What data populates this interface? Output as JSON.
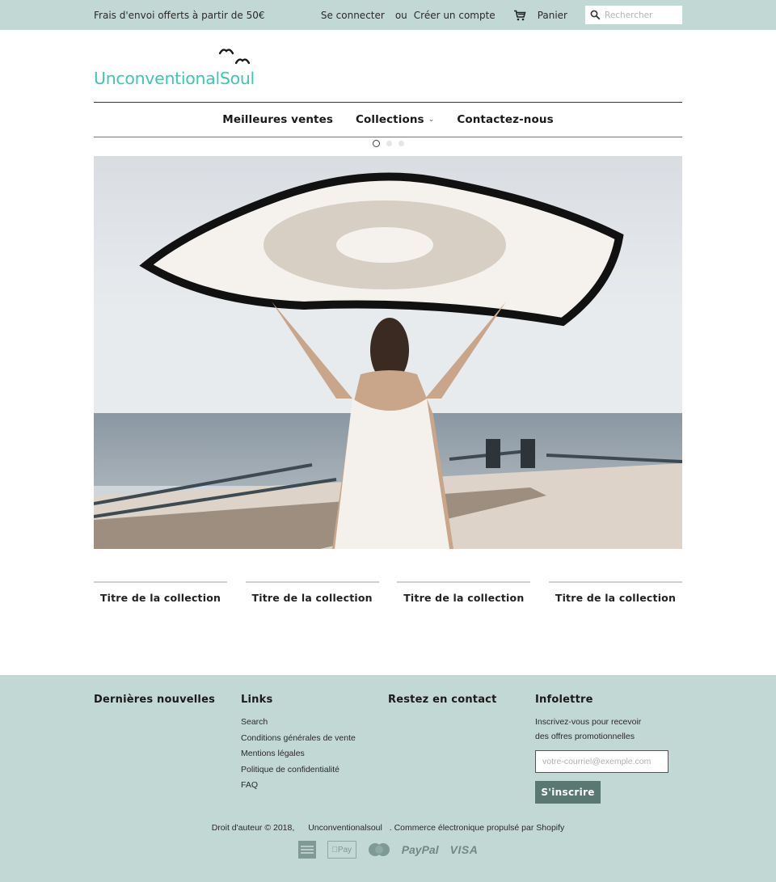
{
  "topbar": {
    "promo": "Frais d'envoi offerts à partir de 50€",
    "login": "Se connecter",
    "or": "ou",
    "register": "Créer un compte",
    "cart_icon": "cart-icon",
    "cart_label": "Panier",
    "search_icon": "search-icon",
    "search_placeholder": "Rechercher"
  },
  "brand": {
    "logo_text": "UnconventionalSoul",
    "logo_color": "#3dc7b2"
  },
  "nav": {
    "items": [
      {
        "label": "Meilleures ventes",
        "has_dropdown": false
      },
      {
        "label": "Collections",
        "has_dropdown": true,
        "dropdown_icon": "chevron-down-icon"
      },
      {
        "label": "Contactez-nous",
        "has_dropdown": false
      }
    ]
  },
  "slideshow": {
    "slide_count": 3,
    "active_slide": 1,
    "image_description": "Woman in white dress holding a round fringed beach towel above her head on a seaside pier"
  },
  "collections": [
    {
      "title": "Titre de la collection"
    },
    {
      "title": "Titre de la collection"
    },
    {
      "title": "Titre de la collection"
    },
    {
      "title": "Titre de la collection"
    }
  ],
  "footer": {
    "news_title": "Dernières nouvelles",
    "links_title": "Links",
    "links": [
      "Search",
      "Conditions générales de vente",
      "Mentions légales",
      "Politique de confidentialité",
      "FAQ"
    ],
    "contact_title": "Restez en contact",
    "newsletter_title": "Infolettre",
    "newsletter_desc_1": "Inscrivez-vous pour recevoir",
    "newsletter_desc_2": "des offres promotionnelles",
    "email_placeholder": "votre-courriel@exemple.com",
    "subscribe_label": "S'inscrire",
    "copyright_prefix": "Droit d'auteur © 2018,",
    "copyright_brand": "Unconventionalsoul",
    "copyright_suffix": ". Commerce électronique propulsé par Shopify",
    "payments": [
      {
        "name": "american-express-icon",
        "label": "AMERICAN EXPRESS"
      },
      {
        "name": "apple-pay-icon",
        "label": " Pay"
      },
      {
        "name": "mastercard-icon",
        "label": "MasterCard"
      },
      {
        "name": "paypal-icon",
        "label": "PayPal"
      },
      {
        "name": "visa-icon",
        "label": "VISA"
      }
    ]
  },
  "colors": {
    "topbar_bg": "#c2d8d4",
    "footer_bg": "#c2d8d4",
    "button_bg": "#5a7772"
  }
}
